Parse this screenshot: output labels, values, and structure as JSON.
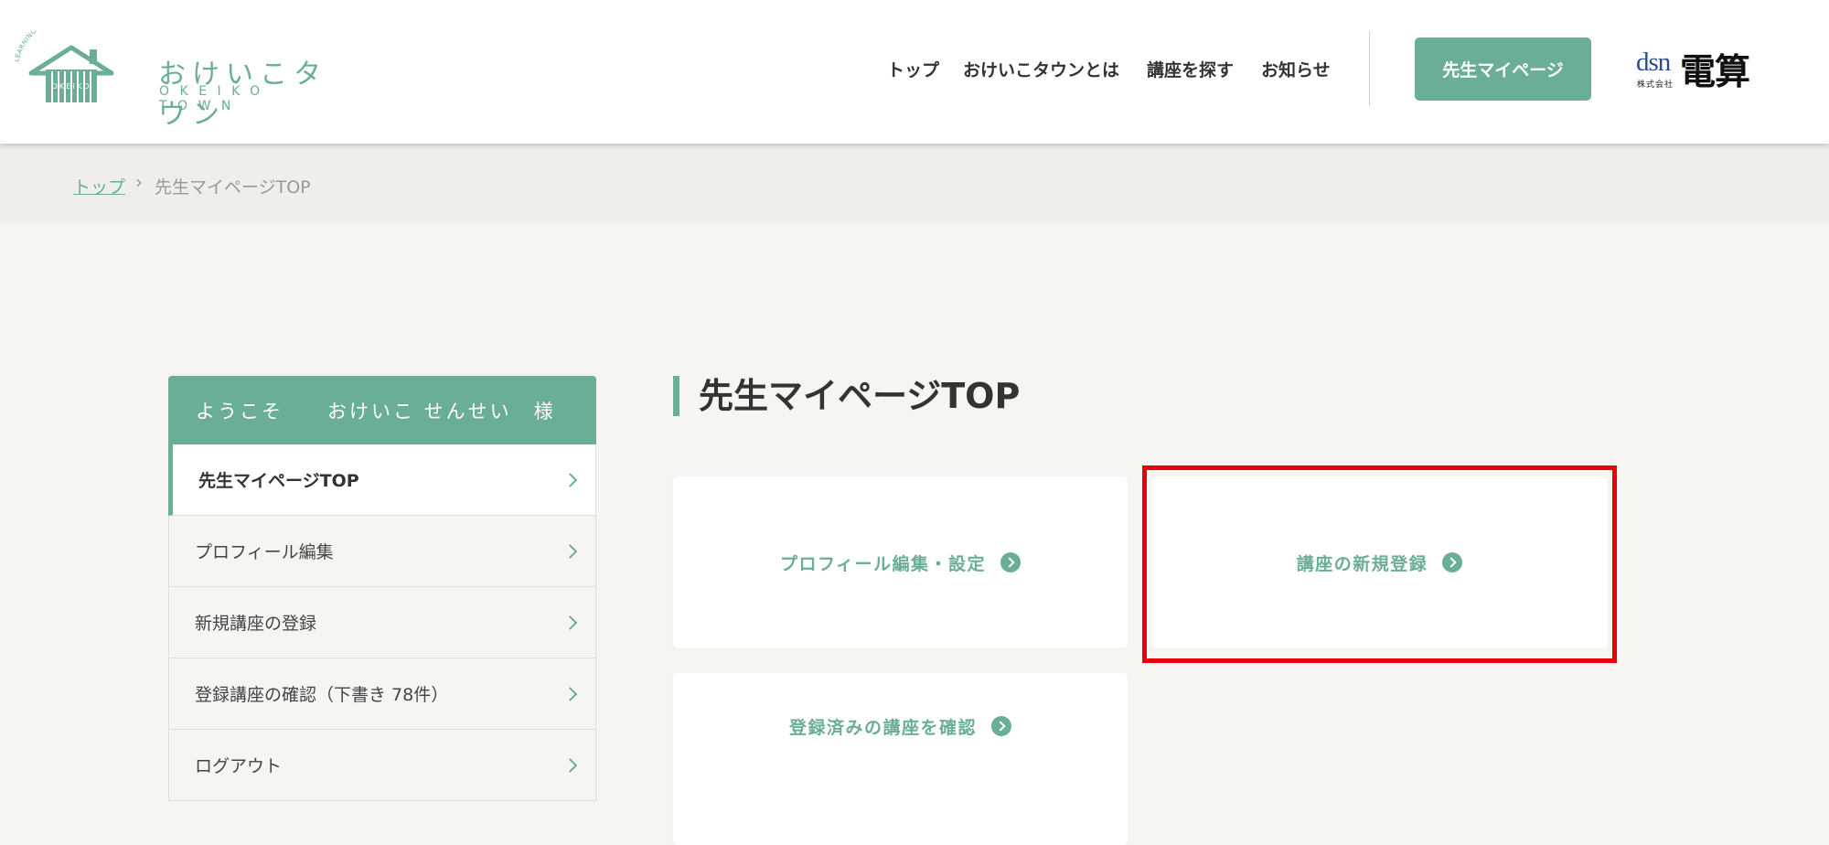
{
  "header": {
    "logo": {
      "title_jp": "おけいこタウン",
      "title_en": "OKEIKO TOWN",
      "tagline": "LEARNING TEACHING TOGETHER",
      "house_text": "OKEIKO"
    },
    "nav": [
      {
        "label": "トップ"
      },
      {
        "label": "おけいこタウンとは"
      },
      {
        "label": "講座を探す"
      },
      {
        "label": "お知らせ"
      }
    ],
    "mypage_button": "先生マイページ",
    "partner_logo": {
      "dsn": "dsn",
      "company": "株式会社",
      "name": "電算"
    }
  },
  "breadcrumb": {
    "top": "トップ",
    "separator": "›",
    "current": "先生マイページTOP"
  },
  "sidebar": {
    "welcome": "ようこそ　　おけいこ せんせい　様",
    "items": [
      {
        "label": "先生マイページTOP"
      },
      {
        "label": "プロフィール編集"
      },
      {
        "label": "新規講座の登録"
      },
      {
        "label": "登録講座の確認（下書き 78件）"
      },
      {
        "label": "ログアウト"
      }
    ]
  },
  "main": {
    "title": "先生マイページTOP",
    "cards": [
      {
        "label": "プロフィール編集・設定"
      },
      {
        "label": "講座の新規登録"
      },
      {
        "label": "登録済みの講座を確認"
      }
    ]
  },
  "colors": {
    "accent": "#6aae96",
    "highlight": "#e8000b",
    "background": "#f6f5f2"
  }
}
